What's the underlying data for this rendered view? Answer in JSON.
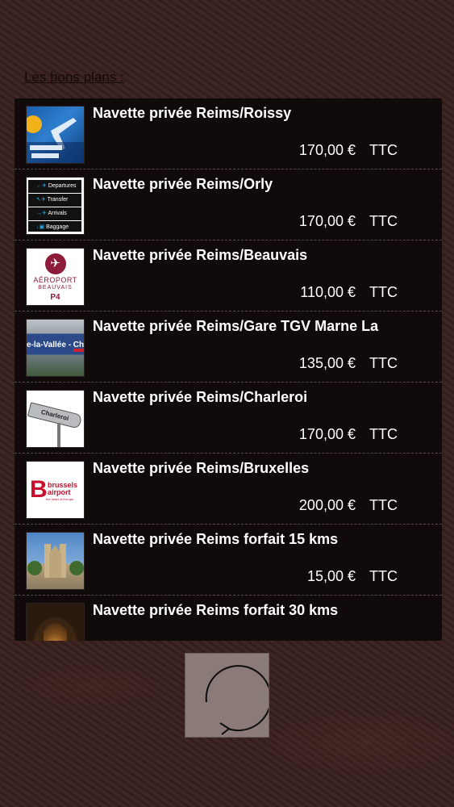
{
  "section_title": "Les bons plans :",
  "rows": [
    {
      "title": "Navette privée Reims/Roissy",
      "price": "170,00 €",
      "tax": "TTC",
      "icon": "roissy-photo"
    },
    {
      "title": "Navette privée Reims/Orly",
      "price": "170,00 €",
      "tax": "TTC",
      "icon": "orly-signs",
      "sign_lines": [
        "Departures",
        "Transfer",
        "Arrivals",
        "Baggage"
      ]
    },
    {
      "title": "Navette privée Reims/Beauvais",
      "price": "110,00 €",
      "tax": "TTC",
      "icon": "beauvais-logo",
      "logo_lines": [
        "AÉROPORT",
        "BEAUVAIS",
        "P4"
      ]
    },
    {
      "title": "Navette privée Reims/Gare TGV Marne La",
      "price": "135,00 €",
      "tax": "TTC",
      "icon": "gare-sign",
      "sign_text": "e-la-Vallée - Ch"
    },
    {
      "title": "Navette privée Reims/Charleroi",
      "price": "170,00 €",
      "tax": "TTC",
      "icon": "charleroi-sign",
      "sign_text": "Charleroi"
    },
    {
      "title": "Navette privée Reims/Bruxelles",
      "price": "200,00 €",
      "tax": "TTC",
      "icon": "brussels-logo",
      "logo_lines": [
        "brussels",
        "airport",
        "the heart of Europe"
      ]
    },
    {
      "title": "Navette privée Reims forfait 15 kms",
      "price": "15,00 €",
      "tax": "TTC",
      "icon": "cathedral-photo"
    },
    {
      "title": "Navette privée Reims forfait 30 kms",
      "price": "",
      "tax": "",
      "icon": "arch-photo"
    }
  ],
  "refresh_button": {
    "icon": "refresh-icon"
  },
  "colors": {
    "list_bg": "#100b0a",
    "refresh_bg": "#8a7b79",
    "beauvais": "#8c1c3a",
    "brussels": "#c8102e"
  }
}
